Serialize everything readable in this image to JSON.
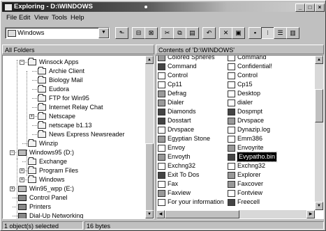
{
  "window": {
    "title": "Exploring - D:\\WINDOWS",
    "min": "_",
    "max": "□",
    "close": "×"
  },
  "menu": [
    "File",
    "Edit",
    "View",
    "Tools",
    "Help"
  ],
  "toolbar": {
    "address": "Windows",
    "buttons": [
      "up-folder",
      "map-drive",
      "disconnect",
      "cut",
      "copy",
      "paste",
      "undo",
      "delete",
      "properties",
      "large-icons",
      "small-icons",
      "list",
      "details"
    ]
  },
  "headers": {
    "left": "All Folders",
    "right": "Contents of 'D:\\WINDOWS'"
  },
  "tree": [
    {
      "label": "Winsock Apps",
      "level": 3,
      "expander": "−",
      "icon": "folder"
    },
    {
      "label": "Archie Client",
      "level": 4,
      "icon": "folder"
    },
    {
      "label": "Biology Mail",
      "level": 4,
      "icon": "folder"
    },
    {
      "label": "Eudora",
      "level": 4,
      "icon": "folder"
    },
    {
      "label": "FTP for Win95",
      "level": 4,
      "icon": "folder"
    },
    {
      "label": "Internet Relay Chat",
      "level": 4,
      "icon": "folder"
    },
    {
      "label": "Netscape",
      "level": 4,
      "expander": "+",
      "icon": "folder"
    },
    {
      "label": "netscape b1.13",
      "level": 4,
      "icon": "folder"
    },
    {
      "label": "News Express Newsreader",
      "level": 4,
      "icon": "folder"
    },
    {
      "label": "Winzip",
      "level": 3,
      "icon": "folder"
    },
    {
      "label": "Windows95 (D:)",
      "level": 1,
      "expander": "−",
      "icon": "drive"
    },
    {
      "label": "Exchange",
      "level": 2,
      "icon": "folder"
    },
    {
      "label": "Program Files",
      "level": 2,
      "expander": "+",
      "icon": "folder"
    },
    {
      "label": "Windows",
      "level": 2,
      "expander": "+",
      "icon": "folder"
    },
    {
      "label": "Win95_wpp (E:)",
      "level": 1,
      "expander": "+",
      "icon": "drive"
    },
    {
      "label": "Control Panel",
      "level": 1,
      "icon": "control"
    },
    {
      "label": "Printers",
      "level": 1,
      "icon": "control"
    },
    {
      "label": "Dial-Up Networking",
      "level": 1,
      "icon": "control"
    }
  ],
  "files_col1": [
    {
      "label": "Colored Spheres",
      "icon": "mid"
    },
    {
      "label": "Command",
      "icon": "dark"
    },
    {
      "label": "Control",
      "icon": "plain"
    },
    {
      "label": "Cp11",
      "icon": "plain"
    },
    {
      "label": "Defrag",
      "icon": "mid"
    },
    {
      "label": "Dialer",
      "icon": "mid"
    },
    {
      "label": "Diamonds",
      "icon": "dark"
    },
    {
      "label": "Dosstart",
      "icon": "dark"
    },
    {
      "label": "Drvspace",
      "icon": "plain"
    },
    {
      "label": "Egyptian Stone",
      "icon": "mid"
    },
    {
      "label": "Envoy",
      "icon": "plain"
    },
    {
      "label": "Envoyth",
      "icon": "mid"
    },
    {
      "label": "Exchng32",
      "icon": "plain"
    },
    {
      "label": "Exit To Dos",
      "icon": "dark"
    },
    {
      "label": "Fax",
      "icon": "plain"
    },
    {
      "label": "Faxview",
      "icon": "mid"
    },
    {
      "label": "For your information",
      "icon": "plain"
    }
  ],
  "files_col2": [
    {
      "label": "Command",
      "icon": "plain"
    },
    {
      "label": "Confidential!",
      "icon": "plain"
    },
    {
      "label": "Control",
      "icon": "plain"
    },
    {
      "label": "Cp15",
      "icon": "plain"
    },
    {
      "label": "Desktop",
      "icon": "plain"
    },
    {
      "label": "dialer",
      "icon": "plain"
    },
    {
      "label": "Dospmpt",
      "icon": "dark"
    },
    {
      "label": "Drvspace",
      "icon": "mid"
    },
    {
      "label": "Dynazip.log",
      "icon": "plain"
    },
    {
      "label": "Emm386",
      "icon": "plain"
    },
    {
      "label": "Envoyrite",
      "icon": "mid"
    },
    {
      "label": "Evypatho.bin",
      "icon": "dark",
      "selected": true
    },
    {
      "label": "Exchng32",
      "icon": "plain"
    },
    {
      "label": "Explorer",
      "icon": "mid"
    },
    {
      "label": "Faxcover",
      "icon": "mid"
    },
    {
      "label": "Fontview",
      "icon": "plain"
    },
    {
      "label": "Freecell",
      "icon": "dark"
    }
  ],
  "status": {
    "left": "1 object(s) selected",
    "right": "16 bytes"
  }
}
